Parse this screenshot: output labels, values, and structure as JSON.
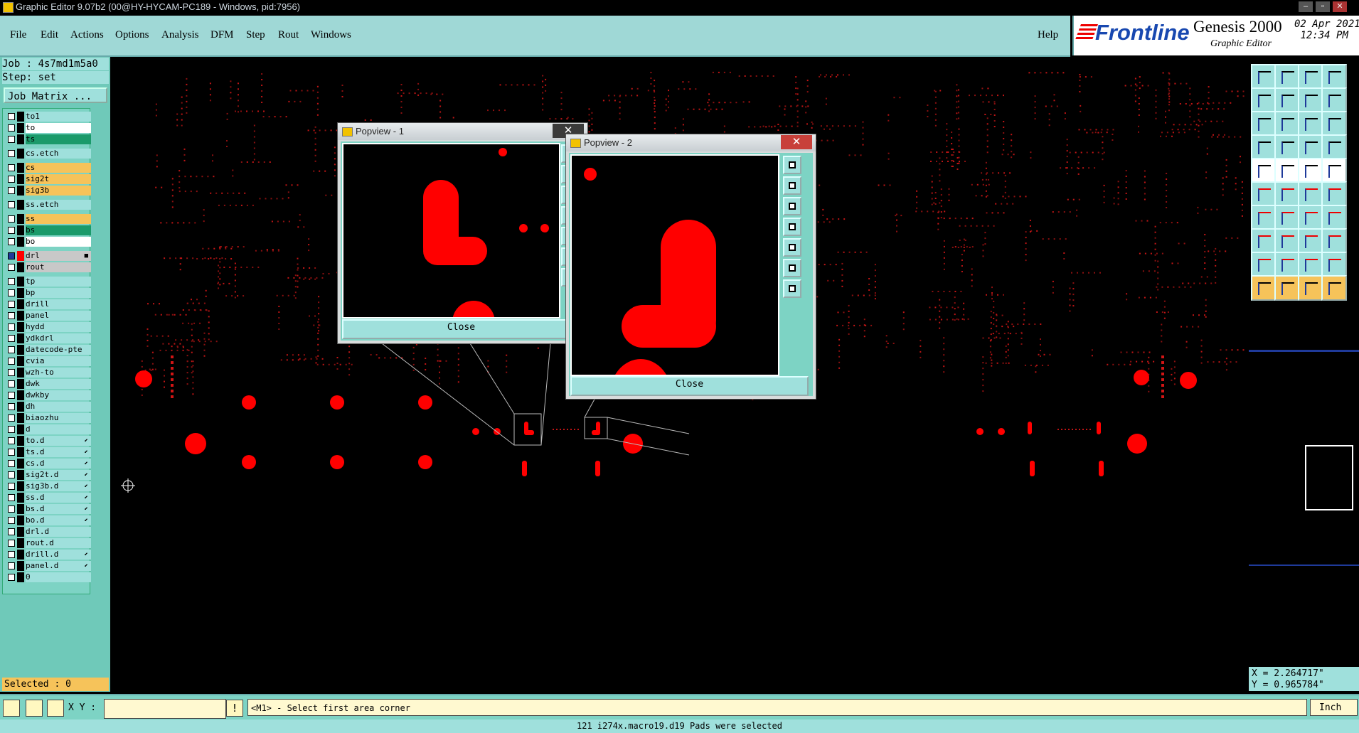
{
  "window": {
    "title": "Graphic Editor 9.07b2 (00@HY-HYCAM-PC189 - Windows, pid:7956)"
  },
  "menu": {
    "items": [
      "File",
      "Edit",
      "Actions",
      "Options",
      "Analysis",
      "DFM",
      "Step",
      "Rout",
      "Windows"
    ],
    "help": "Help"
  },
  "brand": {
    "logo": "Frontline",
    "product": "Genesis 2000",
    "subtitle": "Graphic Editor",
    "date": "02 Apr 2021",
    "time": "12:34 PM"
  },
  "job": {
    "job_label": "Job : 4s7md1m5a0",
    "step_label": "Step: set",
    "matrix_button": "Job Matrix ..."
  },
  "layers": [
    {
      "name": "to1",
      "bg": "#9fe0dc"
    },
    {
      "name": "to",
      "bg": "#ffffff"
    },
    {
      "name": "ts",
      "bg": "#1a9a6a"
    },
    {
      "name": "cs.etch",
      "bg": "#9fe0dc"
    },
    {
      "name": "cs",
      "bg": "#f6c35a"
    },
    {
      "name": "sig2t",
      "bg": "#f6c35a"
    },
    {
      "name": "sig3b",
      "bg": "#f6c35a"
    },
    {
      "name": "ss.etch",
      "bg": "#9fe0dc"
    },
    {
      "name": "ss",
      "bg": "#f6c35a"
    },
    {
      "name": "bs",
      "bg": "#1a9a6a"
    },
    {
      "name": "bo",
      "bg": "#ffffff"
    },
    {
      "name": "drl",
      "bg": "#c8c8c8",
      "active": true
    },
    {
      "name": "rout",
      "bg": "#c8c8c8"
    },
    {
      "name": "tp",
      "bg": "#9fe0dc"
    },
    {
      "name": "bp",
      "bg": "#9fe0dc"
    },
    {
      "name": "drill",
      "bg": "#9fe0dc"
    },
    {
      "name": "panel",
      "bg": "#9fe0dc"
    },
    {
      "name": "hydd",
      "bg": "#9fe0dc"
    },
    {
      "name": "ydkdrl",
      "bg": "#9fe0dc"
    },
    {
      "name": "datecode-pte",
      "bg": "#9fe0dc"
    },
    {
      "name": "cvia",
      "bg": "#9fe0dc"
    },
    {
      "name": "wzh-to",
      "bg": "#9fe0dc"
    },
    {
      "name": "dwk",
      "bg": "#9fe0dc"
    },
    {
      "name": "dwkby",
      "bg": "#9fe0dc"
    },
    {
      "name": "dh",
      "bg": "#9fe0dc"
    },
    {
      "name": "biaozhu",
      "bg": "#9fe0dc"
    },
    {
      "name": "d",
      "bg": "#9fe0dc"
    },
    {
      "name": "to.d",
      "bg": "#9fe0dc",
      "flag": true
    },
    {
      "name": "ts.d",
      "bg": "#9fe0dc",
      "flag": true
    },
    {
      "name": "cs.d",
      "bg": "#9fe0dc",
      "flag": true
    },
    {
      "name": "sig2t.d",
      "bg": "#9fe0dc",
      "flag": true
    },
    {
      "name": "sig3b.d",
      "bg": "#9fe0dc",
      "flag": true
    },
    {
      "name": "ss.d",
      "bg": "#9fe0dc",
      "flag": true
    },
    {
      "name": "bs.d",
      "bg": "#9fe0dc",
      "flag": true
    },
    {
      "name": "bo.d",
      "bg": "#9fe0dc",
      "flag": true
    },
    {
      "name": "drl.d",
      "bg": "#9fe0dc"
    },
    {
      "name": "rout.d",
      "bg": "#9fe0dc"
    },
    {
      "name": "drill.d",
      "bg": "#9fe0dc",
      "flag": true
    },
    {
      "name": "panel.d",
      "bg": "#9fe0dc",
      "flag": true
    },
    {
      "name": "0",
      "bg": "#9fe0dc"
    }
  ],
  "selected_label": "Selected : 0",
  "popview1": {
    "title": "Popview - 1",
    "close": "Close"
  },
  "popview2": {
    "title": "Popview - 2",
    "close": "Close"
  },
  "coords": {
    "x": "X = 2.264717\"",
    "y": "Y = 0.965784\""
  },
  "command": {
    "xy_label": "X Y :",
    "xy_value": "",
    "prompt": "<M1> - Select first area corner",
    "unit": "Inch"
  },
  "status": "121 i274x.macro19.d19 Pads were selected",
  "colors": {
    "panel": "#9fe0dc",
    "accent_red": "#ff0000",
    "selected": "#f6c35a"
  }
}
